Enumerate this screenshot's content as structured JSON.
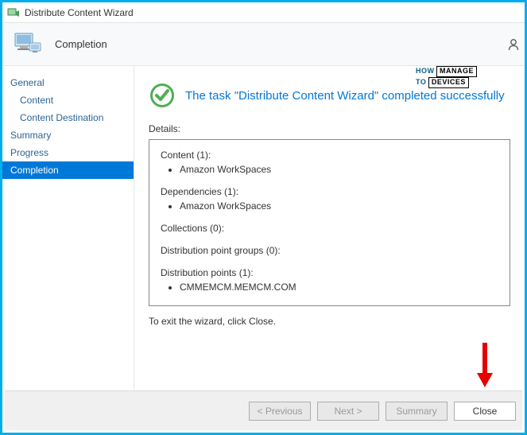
{
  "window": {
    "title": "Distribute Content Wizard"
  },
  "header": {
    "title": "Completion"
  },
  "sidebar": {
    "items": [
      {
        "label": "General",
        "indent": false,
        "active": false
      },
      {
        "label": "Content",
        "indent": true,
        "active": false
      },
      {
        "label": "Content Destination",
        "indent": true,
        "active": false
      },
      {
        "label": "Summary",
        "indent": false,
        "active": false
      },
      {
        "label": "Progress",
        "indent": false,
        "active": false
      },
      {
        "label": "Completion",
        "indent": false,
        "active": true
      }
    ]
  },
  "status": {
    "message": "The task \"Distribute Content Wizard\" completed successfully"
  },
  "details": {
    "label": "Details:",
    "content_header": "Content (1):",
    "content_items": [
      "Amazon WorkSpaces"
    ],
    "dependencies_header": "Dependencies (1):",
    "dependencies_items": [
      "Amazon WorkSpaces"
    ],
    "collections_header": "Collections (0):",
    "dpg_header": "Distribution point groups (0):",
    "dp_header": "Distribution points (1):",
    "dp_items": [
      "CMMEMCM.MEMCM.COM"
    ]
  },
  "exit_hint": "To exit the wizard, click Close.",
  "footer": {
    "previous": "< Previous",
    "next": "Next >",
    "summary": "Summary",
    "close": "Close"
  },
  "watermark": {
    "line1": "HOW",
    "line2": "TO",
    "line3": "MANAGE",
    "line4": "DEVICES"
  }
}
